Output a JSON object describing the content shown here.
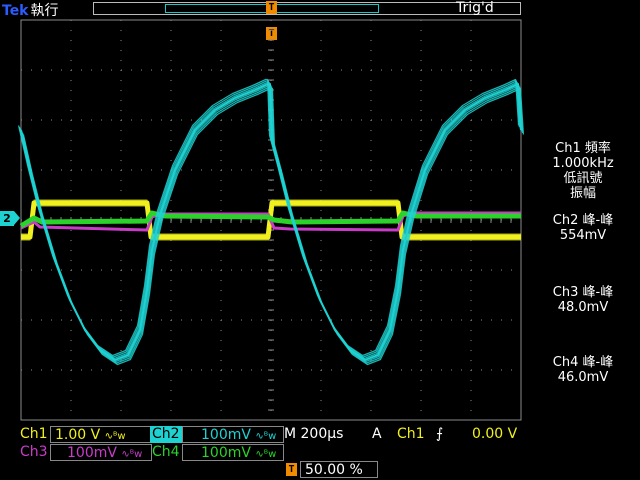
{
  "header": {
    "brand": "Tek",
    "status": "執行",
    "trig_status": "Trig'd",
    "trigger_marker": "T"
  },
  "channel_marker": "2",
  "colors": {
    "ch1": "#f0f01e",
    "ch2": "#1ed2d2",
    "ch3": "#c83cc8",
    "ch4": "#2ad22a",
    "grid": "#8a8a8a",
    "trigger": "#f08a00"
  },
  "measurements": [
    {
      "line1": "Ch1 頻率",
      "line2": "1.000kHz",
      "line3": "低訊號",
      "line4": "振幅",
      "color": "#f0f01e"
    },
    {
      "line1": "Ch2 峰-峰",
      "line2": "554mV",
      "color": "#1ed2d2"
    },
    {
      "line1": "Ch3 峰-峰",
      "line2": "48.0mV",
      "color": "#c83cc8"
    },
    {
      "line1": "Ch4 峰-峰",
      "line2": "46.0mV",
      "color": "#2ad22a"
    }
  ],
  "bottom": {
    "ch1": {
      "label": "Ch1",
      "scale": "1.00 V",
      "coupling": "∿ᴮw"
    },
    "ch2": {
      "label": "Ch2",
      "scale": "100mV",
      "coupling": "∿ᴮw"
    },
    "ch3": {
      "label": "Ch3",
      "scale": "100mV",
      "coupling": "∿ᴮw"
    },
    "ch4": {
      "label": "Ch4",
      "scale": "100mV",
      "coupling": "∿ᴮw"
    },
    "timebase": "M 200µs",
    "trigger_mode": "A",
    "trigger_source": "Ch1",
    "trigger_slope": "⨍",
    "trigger_level": "0.00 V",
    "trigger_position_icon": "T",
    "trigger_position": "50.00 %"
  }
}
